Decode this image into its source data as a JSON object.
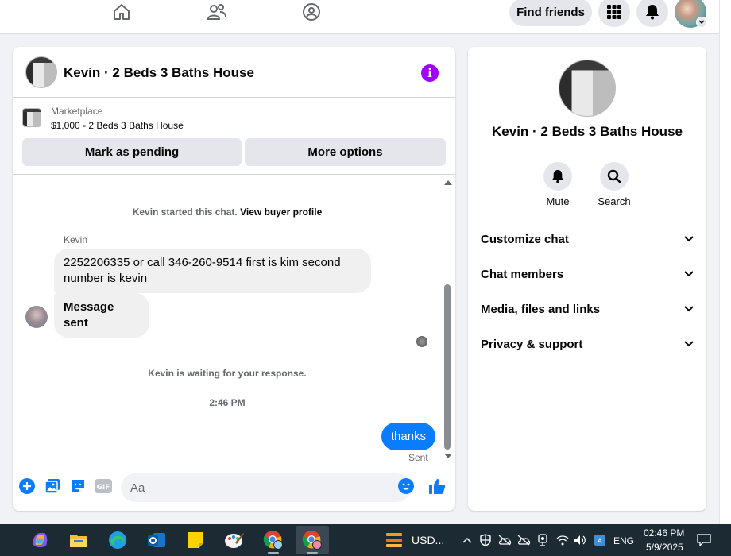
{
  "topnav": {
    "find_friends_label": "Find friends"
  },
  "chat": {
    "title": "Kevin · 2 Beds 3 Baths House",
    "listing": {
      "source": "Marketplace",
      "price_title": "$1,000 - 2 Beds 3 Baths House",
      "mark_pending_label": "Mark as pending",
      "more_options_label": "More options"
    },
    "messages": {
      "started_text": "Kevin started this chat.",
      "view_profile_link": "View buyer profile",
      "sender_name": "Kevin",
      "incoming_1": "2252206335 or call 346-260-9514  first is kim second number is kevin",
      "incoming_2": "Message sent",
      "waiting_text": "Kevin is waiting for your response.",
      "timestamp": "2:46 PM",
      "outgoing_1": "thanks",
      "outgoing_status": "Sent"
    },
    "composer": {
      "placeholder": "Aa"
    }
  },
  "info_panel": {
    "name": "Kevin · 2 Beds 3 Baths House",
    "actions": [
      {
        "label": "Mute",
        "icon": "bell-icon"
      },
      {
        "label": "Search",
        "icon": "search-icon"
      }
    ],
    "sections": [
      {
        "label": "Customize chat"
      },
      {
        "label": "Chat members"
      },
      {
        "label": "Media, files and links"
      },
      {
        "label": "Privacy & support"
      }
    ]
  },
  "taskbar": {
    "stock_label": "USD...",
    "language": "ENG",
    "time": "02:46 PM",
    "date": "5/9/2025"
  },
  "colors": {
    "messenger_blue": "#0a7cff",
    "info_purple": "#a100ff",
    "taskbar_bg": "#1c2a34"
  }
}
